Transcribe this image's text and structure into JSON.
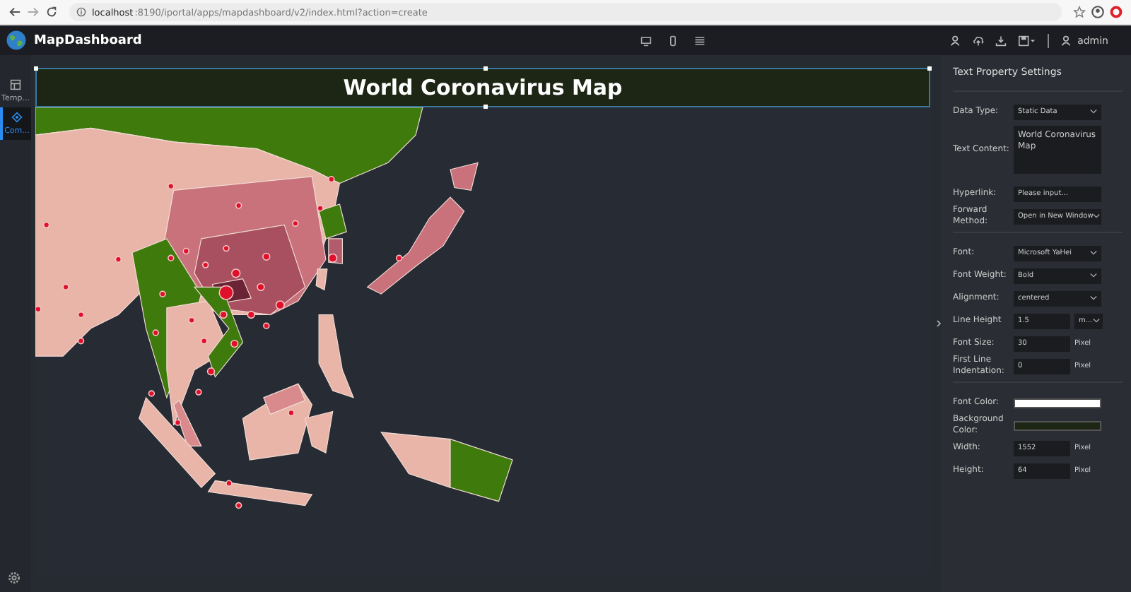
{
  "browser": {
    "url_host": "localhost",
    "url_path": ":8190/iportal/apps/mapdashboard/v2/index.html?action=create"
  },
  "app": {
    "name": "MapDashboard",
    "user": "admin"
  },
  "sidebar": {
    "items": [
      {
        "label": "Temp...",
        "selected": false
      },
      {
        "label": "Com...",
        "selected": true
      }
    ]
  },
  "canvas": {
    "title": "World Coronavirus Map"
  },
  "panel": {
    "title": "Text Property Settings",
    "groups": [
      [
        {
          "kind": "select",
          "label": "Data Type:",
          "value": "Static Data"
        },
        {
          "kind": "textarea",
          "label": "Text Content:",
          "value": "World Coronavirus Map"
        },
        {
          "kind": "input",
          "label": "Hyperlink:",
          "placeholder": "Please input..."
        },
        {
          "kind": "select",
          "label": "Forward Method:",
          "value": "Open in New Window"
        }
      ],
      [
        {
          "kind": "select",
          "label": "Font:",
          "value": "Microsoft YaHei"
        },
        {
          "kind": "select",
          "label": "Font Weight:",
          "value": "Bold"
        },
        {
          "kind": "select",
          "label": "Alignment:",
          "value": "centered"
        },
        {
          "kind": "combo",
          "label": "Line Height",
          "value": "1.5",
          "unit": "m..."
        },
        {
          "kind": "unit",
          "label": "Font Size:",
          "value": "30",
          "unit": "Pixel"
        },
        {
          "kind": "unit",
          "label": "First Line Indentation:",
          "value": "0",
          "unit": "Pixel"
        }
      ],
      [
        {
          "kind": "color",
          "label": "Font Color:",
          "color": "#ffffff"
        },
        {
          "kind": "color",
          "label": "Background Color:",
          "color": "#1d2614"
        },
        {
          "kind": "unit",
          "label": "Width:",
          "value": "1552",
          "unit": "Pixel"
        },
        {
          "kind": "unit",
          "label": "Height:",
          "value": "64",
          "unit": "Pixel"
        }
      ]
    ]
  }
}
